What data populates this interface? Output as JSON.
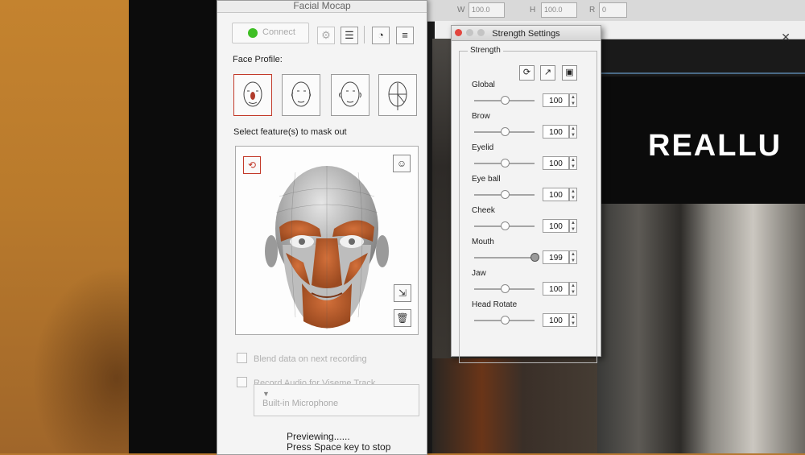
{
  "background_app": {
    "toolbar": {
      "w_label": "W",
      "w_value": "100.0",
      "h_label": "H",
      "h_value": "100.0",
      "r_label": "R",
      "r_value": "0"
    },
    "close_glyph": "✕",
    "brand_text": "REALLU"
  },
  "mocap": {
    "title": "Facial Mocap",
    "connect_label": "Connect",
    "face_profile_label": "Face Profile:",
    "mask_label": "Select feature(s) to mask out",
    "blend_label": "Blend data on next recording",
    "record_audio_label": "Record Audio for Viseme Track",
    "microphone": "Built-in Microphone",
    "preview_line1": "Previewing......",
    "preview_line2": "Press Space key to stop"
  },
  "strength": {
    "title": "Strength Settings",
    "group_label": "Strength",
    "rows": [
      {
        "label": "Global",
        "value": 100
      },
      {
        "label": "Brow",
        "value": 100
      },
      {
        "label": "Eyelid",
        "value": 100
      },
      {
        "label": "Eye ball",
        "value": 100
      },
      {
        "label": "Cheek",
        "value": 100
      },
      {
        "label": "Mouth",
        "value": 199
      },
      {
        "label": "Jaw",
        "value": 100
      },
      {
        "label": "Head Rotate",
        "value": 100
      }
    ]
  },
  "colors": {
    "accent_red": "#c23a2a",
    "connect_green": "#3fbf25",
    "mask_orange": "#c9642f"
  }
}
